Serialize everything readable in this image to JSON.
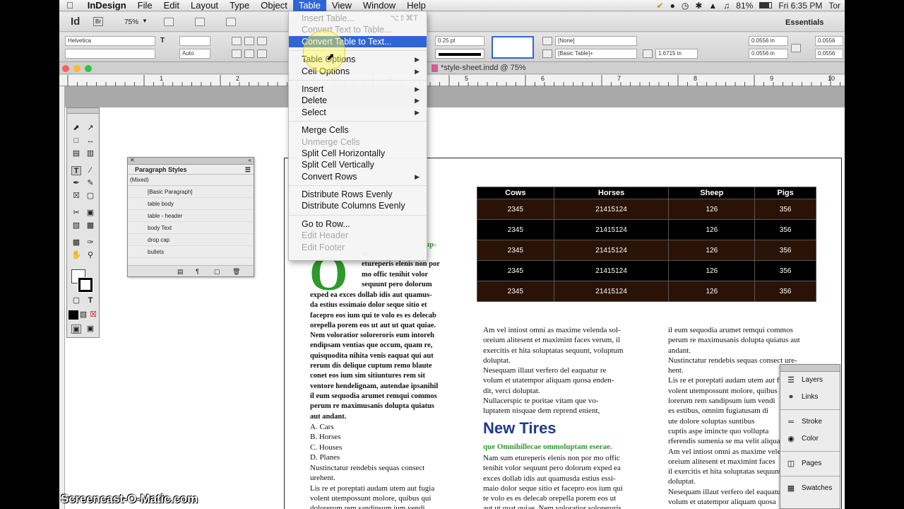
{
  "menubar": {
    "app": "InDesign",
    "items": [
      "File",
      "Edit",
      "Layout",
      "Type",
      "Object",
      "Table",
      "View",
      "Window",
      "Help"
    ],
    "active": "Table",
    "battery": "81%",
    "clock": "Fri 6:35 PM",
    "user": "Tor"
  },
  "control": {
    "app_badge": "Id",
    "bridge_badge": "Br",
    "zoom": "75%",
    "workspace": "Essentials",
    "font": "Helvetica",
    "leading": "Auto",
    "stroke_weight": "0.25 pt",
    "cell_style": "[None]",
    "table_style": "[Basic Table]+",
    "row_height": "1.6715 in",
    "inset_top": "0.0556 in",
    "inset_bottom": "0.0556 in",
    "inset_right_top": "0.0556",
    "inset_right_bottom": "0.0556"
  },
  "document": {
    "title": "*style-sheet.indd @ 75%",
    "ruler_labels": [
      "1",
      "2",
      "3",
      "4",
      "5",
      "6",
      "7",
      "8",
      "9",
      "10"
    ]
  },
  "table_menu": {
    "items": [
      {
        "label": "Insert Table...",
        "shortcut": "⌥⇧⌘T",
        "disabled": true
      },
      {
        "label": "Convert Text to Table...",
        "disabled": true
      },
      {
        "label": "Convert Table to Text...",
        "highlighted": true
      },
      {
        "sep": true
      },
      {
        "label": "Table Options",
        "submenu": true
      },
      {
        "label": "Cell Options",
        "submenu": true
      },
      {
        "sep": true
      },
      {
        "label": "Insert",
        "submenu": true
      },
      {
        "label": "Delete",
        "submenu": true
      },
      {
        "label": "Select",
        "submenu": true
      },
      {
        "sep": true
      },
      {
        "label": "Merge Cells"
      },
      {
        "label": "Unmerge Cells",
        "disabled": true
      },
      {
        "label": "Split Cell Horizontally"
      },
      {
        "label": "Split Cell Vertically"
      },
      {
        "label": "Convert Rows",
        "submenu": true
      },
      {
        "sep": true
      },
      {
        "label": "Distribute Rows Evenly"
      },
      {
        "label": "Distribute Columns Evenly"
      },
      {
        "sep": true
      },
      {
        "label": "Go to Row..."
      },
      {
        "label": "Edit Header",
        "disabled": true
      },
      {
        "label": "Edit Footer",
        "disabled": true
      }
    ]
  },
  "paragraph_styles": {
    "title": "Paragraph Styles",
    "current": "(Mixed)",
    "items": [
      "[Basic Paragraph]",
      "table body",
      "table - header",
      "body Text",
      "drop cap",
      "bullets"
    ]
  },
  "table": {
    "headers": [
      "Cows",
      "Horses",
      "Sheep",
      "Pigs"
    ],
    "rows": [
      [
        "2345",
        "21415124",
        "126",
        "356"
      ],
      [
        "2345",
        "21415124",
        "126",
        "356"
      ],
      [
        "2345",
        "21415124",
        "126",
        "356"
      ],
      [
        "2345",
        "21415124",
        "126",
        "356"
      ],
      [
        "2345",
        "21415124",
        "126",
        "356"
      ]
    ]
  },
  "text": {
    "green_top": "dup-",
    "dropcap": "O",
    "col1_beside": [
      "m",
      "etureperis elenis non por",
      "mo offic tenihit volor",
      "sequunt pero dolorum"
    ],
    "col1": [
      "exped ea exces dollab idis aut quamus-",
      "da estius essimaio dolor seque sitio et",
      "facepro eos ium qui te volo es es delecab",
      "orepella porem eos ut aut ut quat quiae.",
      "Nem voloratior soloreroris eum intoreh",
      "endipsam ventias que occum, quam re,",
      "quisquodita nihita venis eaquat qui aut",
      "rerum dis delique cuptum remo blaute",
      "conet eos ium sim sitiuntures rem sit",
      "ventore hendelignam, autendae ipsanihil",
      "il eum sequodia arumet remqui commos",
      "perum re maximusanis dolupta quiatus",
      "aut andant."
    ],
    "list": [
      "A.  Cars",
      "B.  Horses",
      "C.  Houses",
      "D.  Planes"
    ],
    "col1_tail": [
      "Nustinctatur rendebis sequas consect",
      "urehent.",
      "Lis re et poreptati audam utem aut fugia",
      "volent utempossunt molore, quibus qui",
      "dolorerum rem sandipsum ium vendi"
    ],
    "col2": [
      "Am vel intiost omni as maxime velenda sol-",
      "oreium alitesent et maximint faces verum, il",
      "exercitis et hita soluptatas sequunt, voluptum",
      "doluptat.",
      "Nesequam illaut verfero del eaquatur re",
      "volum et utatempor aliquam quosa enden-",
      "dit, verci doluptat.",
      "Nullacerspic te poritae vitam que vo-",
      "luptatem nisquae dem reprend enient,"
    ],
    "heading": "New Tires",
    "subhead": "que Omnihillecae ommoluptam eserae.",
    "col2_tail": [
      "Nam sum etureperis elenis non por mo offic",
      "tenihit volor sequunt pero dolorum exped ea",
      "exces dollab idis aut quamusda estius essi-",
      "maio dolor seque sitio et facepro eos ium qui",
      "te volo es es delecab orepella porem eos ut",
      "aut ut quat quiae. Nem voloratior soloreroris"
    ],
    "col3": [
      "il eum sequodia arumet remqui commos",
      "perum re maximusanis dolupta quiatus aut",
      "andant.",
      "Nustinctatur rendebis sequas consect ure-",
      "hent.",
      "Lis re et poreptati audam utem aut fugia",
      "volent utempossunt molore, quibus qui",
      "lorerum rem sandipsum ium vendi",
      "es estibus, omnim fugiatusam di",
      "ute dolore soluptas suntibus",
      "cuptis aspe imincte quo vollupta",
      "rferendis sumenia se ma velit aliqua",
      "Am vel intiost omni as maxime velenda",
      "oreium alitesent et maximint faces",
      "il exercitis et hita soluptatas sequunt",
      "doluptat.",
      "Nesequam illaut verfero del eaquatur",
      "volum et utatempor aliquam quosa"
    ]
  },
  "right_panel": {
    "items": [
      {
        "label": "Layers",
        "icon": "layers-icon"
      },
      {
        "label": "Links",
        "icon": "links-icon"
      },
      {
        "label": "Stroke",
        "icon": "stroke-icon"
      },
      {
        "label": "Color",
        "icon": "color-icon"
      },
      {
        "label": "Pages",
        "icon": "pages-icon"
      },
      {
        "label": "Swatches",
        "icon": "swatches-icon"
      }
    ]
  },
  "watermark": "Screencast-O-Matic.com",
  "colors": {
    "menu_highlight": "#2f66d6",
    "accent_green": "#2d9a2a",
    "heading_blue": "#1f3a8c",
    "table_odd": "#2a1306"
  }
}
